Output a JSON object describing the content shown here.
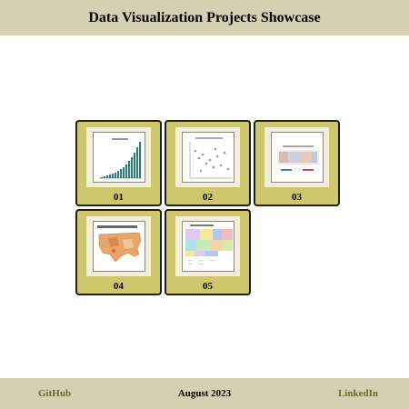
{
  "header": {
    "title": "Data Visualization Projects Showcase"
  },
  "projects": [
    {
      "number": "01",
      "thumb_icon": "bar-chart-thumbnail"
    },
    {
      "number": "02",
      "thumb_icon": "scatter-plot-thumbnail"
    },
    {
      "number": "03",
      "thumb_icon": "heatmap-thumbnail"
    },
    {
      "number": "04",
      "thumb_icon": "choropleth-map-thumbnail"
    },
    {
      "number": "05",
      "thumb_icon": "treemap-thumbnail"
    }
  ],
  "footer": {
    "github": "GitHub",
    "date": "August 2023",
    "linkedin": "LinkedIn"
  },
  "colors": {
    "header_bg": "#d6d0b2",
    "card_bg": "#cfc76c",
    "frame_bg": "#f2eedd",
    "link": "#6e6a1c"
  }
}
